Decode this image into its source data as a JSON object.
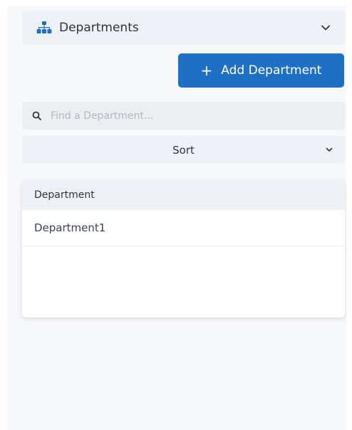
{
  "department_selector": {
    "label": "Departments",
    "icon": "org-chart-icon",
    "accent_color": "#1f6fc5"
  },
  "add_button": {
    "label": "Add Department",
    "icon": "plus-icon",
    "color": "#1f6fc5"
  },
  "search": {
    "placeholder": "Find a Department...",
    "value": "",
    "icon": "search-icon"
  },
  "sort": {
    "label": "Sort"
  },
  "table": {
    "header": "Department",
    "rows": [
      {
        "name": "Department1"
      }
    ]
  }
}
